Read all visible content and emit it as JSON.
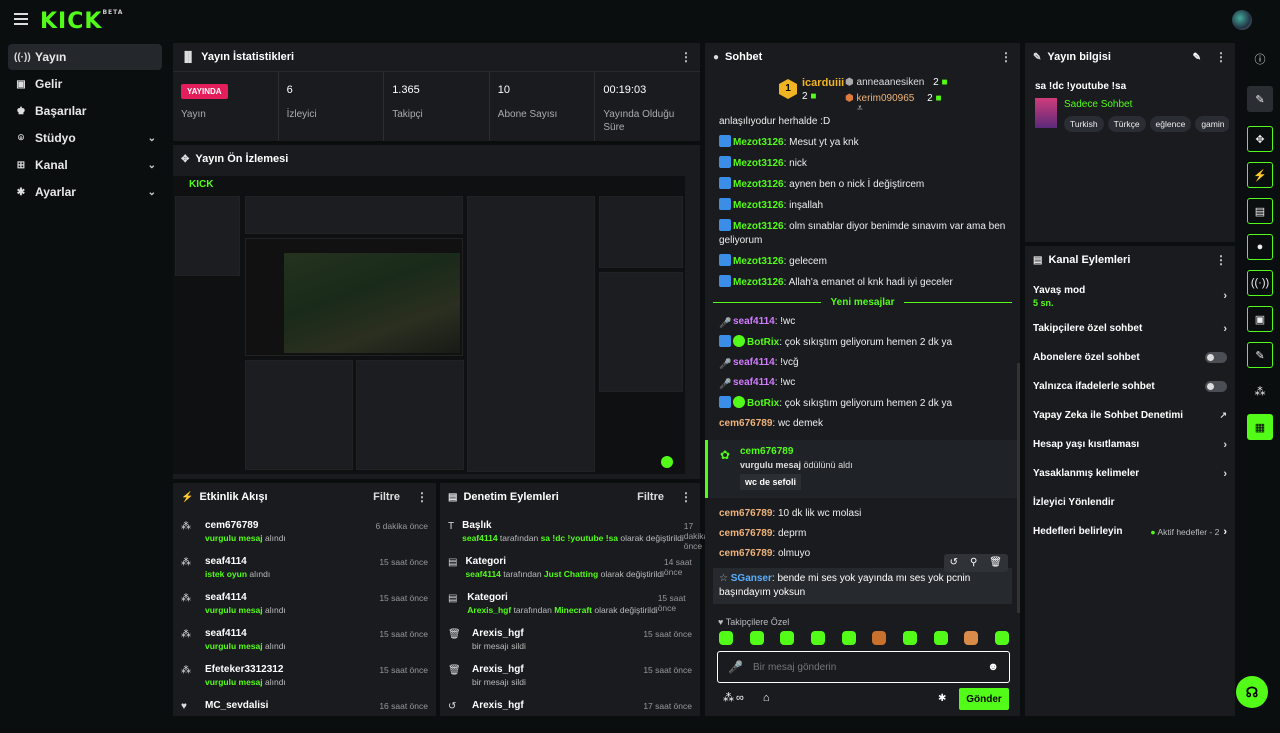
{
  "app": {
    "logo": "KICK",
    "logo_badge": "BETA"
  },
  "sidebar": {
    "items": [
      {
        "label": "Yayın",
        "icon": "broadcast-icon",
        "glyph": "((·))"
      },
      {
        "label": "Gelir",
        "icon": "wallet-icon",
        "glyph": "▣"
      },
      {
        "label": "Başarılar",
        "icon": "trophy-icon",
        "glyph": "♚"
      },
      {
        "label": "Stüdyo",
        "icon": "studio-icon",
        "glyph": "⌾"
      },
      {
        "label": "Kanal",
        "icon": "channel-icon",
        "glyph": "⊞"
      },
      {
        "label": "Ayarlar",
        "icon": "gear-icon",
        "glyph": "✱"
      }
    ]
  },
  "stats": {
    "title": "Yayın İstatistikleri",
    "live_label": "YAYINDA",
    "live_sub": "Yayın",
    "items": [
      {
        "value": "6",
        "label": "İzleyici"
      },
      {
        "value": "1.365",
        "label": "Takipçi"
      },
      {
        "value": "10",
        "label": "Abone Sayısı"
      },
      {
        "value": "00:19:03",
        "label": "Yayında Olduğu Süre"
      }
    ]
  },
  "preview": {
    "title": "Yayın Ön İzlemesi"
  },
  "activity": {
    "title": "Etkinlik Akışı",
    "filter": "Filtre",
    "rows": [
      {
        "name": "cem676789",
        "hl": "vurgulu mesaj",
        "rest": " alındı",
        "time": "6 dakika önce"
      },
      {
        "name": "seaf4114",
        "hl": "istek oyun",
        "rest": " alındı",
        "time": "15 saat önce"
      },
      {
        "name": "seaf4114",
        "hl": "vurgulu mesaj",
        "rest": " alındı",
        "time": "15 saat önce"
      },
      {
        "name": "seaf4114",
        "hl": "vurgulu mesaj",
        "rest": " alındı",
        "time": "15 saat önce"
      },
      {
        "name": "Efeteker3312312",
        "hl": "vurgulu mesaj",
        "rest": " alındı",
        "time": "15 saat önce"
      },
      {
        "name": "MC_sevdalisi",
        "hl": "",
        "rest": "",
        "time": "16 saat önce"
      }
    ]
  },
  "moderation": {
    "title": "Denetim Eylemleri",
    "filter": "Filtre",
    "rows": [
      {
        "name": "Başlık",
        "user": "seaf4114",
        "mid": " tarafından ",
        "val": "sa !dc !youtube !sa",
        "tail": " olarak değiştirildi",
        "time": "17 dakika önce",
        "glyph": "T"
      },
      {
        "name": "Kategori",
        "user": "seaf4114",
        "mid": " tarafından ",
        "val": "Just Chatting",
        "tail": " olarak değiştirildi",
        "time": "14 saat önce",
        "glyph": "▤"
      },
      {
        "name": "Kategori",
        "user": "Arexis_hgf",
        "mid": " tarafından ",
        "val": "Minecraft",
        "tail": " olarak değiştirildi",
        "time": "15 saat önce",
        "glyph": "▤"
      },
      {
        "name": "Arexis_hgf",
        "user": "",
        "mid": "bir mesajı sildi",
        "val": "",
        "tail": "",
        "time": "15 saat önce",
        "glyph": "🗑"
      },
      {
        "name": "Arexis_hgf",
        "user": "",
        "mid": "bir mesajı sildi",
        "val": "",
        "tail": "",
        "time": "15 saat önce",
        "glyph": "🗑"
      },
      {
        "name": "Arexis_hgf",
        "user": "",
        "mid": "",
        "val": "",
        "tail": "",
        "time": "17 saat önce",
        "glyph": "↺"
      }
    ]
  },
  "chat": {
    "title": "Sohbet",
    "leader": {
      "rank": "1",
      "name": "icarduiii",
      "count": "2"
    },
    "top": [
      {
        "name": "anneaanesiken",
        "count": "2"
      },
      {
        "name": "kerim090965",
        "count": "2"
      }
    ],
    "clipped_text": "anlaşılıyodur herhalde :D",
    "messages": [
      {
        "user": "Mezot3126",
        "cls": "u-green",
        "badge": "blue",
        "text": "Mesut yt ya knk"
      },
      {
        "user": "Mezot3126",
        "cls": "u-green",
        "badge": "blue",
        "text": "nick"
      },
      {
        "user": "Mezot3126",
        "cls": "u-green",
        "badge": "blue",
        "text": "aynen ben o nick İ değiştircem"
      },
      {
        "user": "Mezot3126",
        "cls": "u-green",
        "badge": "blue",
        "text": "inşallah"
      },
      {
        "user": "Mezot3126",
        "cls": "u-green",
        "badge": "blue",
        "text": "olm sınablar diyor benimde sınavım var ama ben geliyorum"
      },
      {
        "user": "Mezot3126",
        "cls": "u-green",
        "badge": "blue",
        "text": "gelecem"
      },
      {
        "user": "Mezot3126",
        "cls": "u-green",
        "badge": "blue",
        "text": "Allah'a emanet ol knk hadi iyi geceler"
      }
    ],
    "new_label": "Yeni mesajlar",
    "messages2": [
      {
        "user": "seaf4114",
        "cls": "u-pink",
        "badge": "mic",
        "text": "!wc"
      },
      {
        "user": "BotRix",
        "cls": "u-green",
        "badge": "bot",
        "text": "çok sıkıştım geliyorum hemen 2 dk ya"
      },
      {
        "user": "seaf4114",
        "cls": "u-pink",
        "badge": "mic",
        "text": "!vcğ"
      },
      {
        "user": "seaf4114",
        "cls": "u-pink",
        "badge": "mic",
        "text": "!wc"
      },
      {
        "user": "BotRix",
        "cls": "u-green",
        "badge": "bot",
        "text": "çok sıkıştım geliyorum hemen 2 dk ya"
      },
      {
        "user": "cem676789",
        "cls": "u-orange",
        "badge": "",
        "text": "wc demek"
      }
    ],
    "highlight": {
      "user": "cem676789",
      "hl": "vurgulu mesaj",
      "rest": " ödülünü aldı",
      "quote": "wc de sefoli"
    },
    "messages3": [
      {
        "user": "cem676789",
        "cls": "u-orange",
        "text": "10 dk lik wc molasi"
      },
      {
        "user": "cem676789",
        "cls": "u-orange",
        "text": "deprm"
      },
      {
        "user": "cem676789",
        "cls": "u-orange",
        "text": "olmuyo"
      }
    ],
    "hover_msg": {
      "user": "SGanser",
      "text": "bende mi ses yok yayında mı ses yok pcnin başındayım yoksun"
    },
    "followers_only": "Takipçilere Özel",
    "input_placeholder": "Bir mesaj gönderin",
    "send": "Gönder"
  },
  "info": {
    "title": "Yayın bilgisi",
    "stream_title": "sa !dc !youtube !sa",
    "category": "Sadece Sohbet",
    "tags": [
      "Turkish",
      "Türkçe",
      "eğlence",
      "gamin"
    ]
  },
  "actions": {
    "title": "Kanal Eylemleri",
    "rows": [
      {
        "label": "Yavaş mod",
        "sub": "5 sn.",
        "kind": "chev"
      },
      {
        "label": "Takipçilere özel sohbet",
        "sub": "",
        "kind": "chev"
      },
      {
        "label": "Abonelere özel sohbet",
        "sub": "",
        "kind": "toggle"
      },
      {
        "label": "Yalnızca ifadelerle sohbet",
        "sub": "",
        "kind": "toggle"
      },
      {
        "label": "Yapay Zeka ile Sohbet Denetimi",
        "sub": "",
        "kind": "ext"
      },
      {
        "label": "Hesap yaşı kısıtlaması",
        "sub": "",
        "kind": "chev"
      },
      {
        "label": "Yasaklanmış kelimeler",
        "sub": "",
        "kind": "chev"
      },
      {
        "label": "İzleyici Yönlendir",
        "sub": "",
        "kind": "none"
      },
      {
        "label": "Hedefleri belirleyin",
        "sub": "",
        "kind": "goal",
        "extra": "Aktif hedefler - 2"
      }
    ]
  },
  "colors": {
    "accent": "#53fc18",
    "live": "#e31e5a",
    "panel": "#191b1f",
    "bg": "#0b0e0f"
  }
}
